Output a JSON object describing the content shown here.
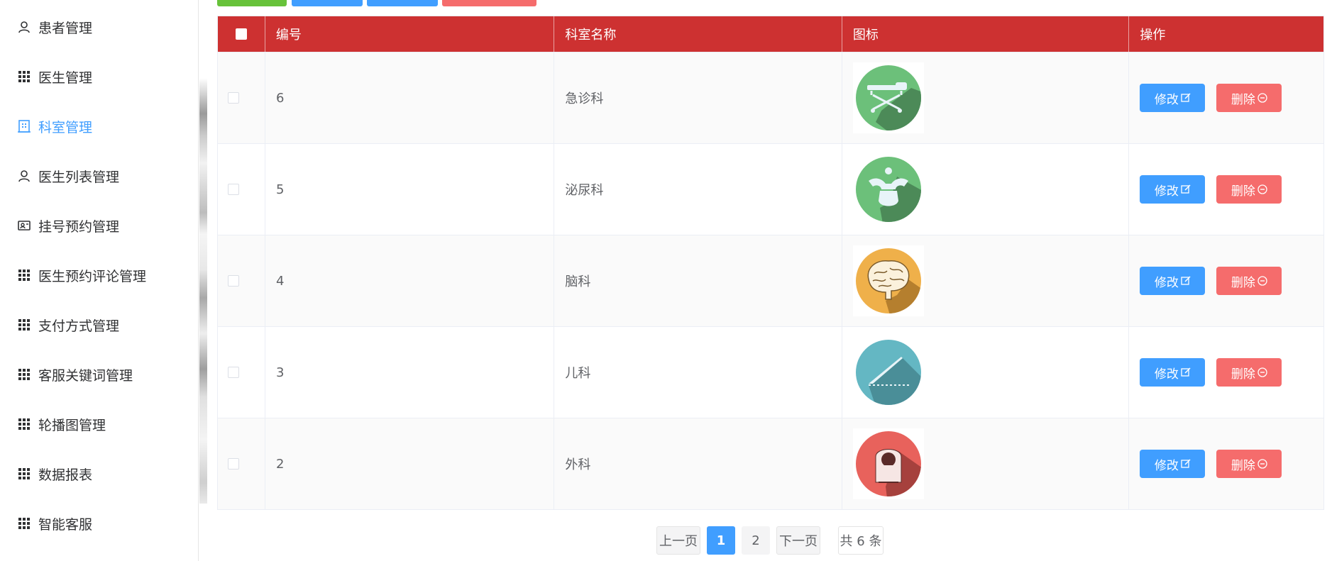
{
  "sidebar": {
    "items": [
      {
        "label": "患者管理",
        "icon": "user-icon",
        "active": false
      },
      {
        "label": "医生管理",
        "icon": "grid-icon",
        "active": false
      },
      {
        "label": "科室管理",
        "icon": "building-icon",
        "active": true
      },
      {
        "label": "医生列表管理",
        "icon": "user-icon",
        "active": false
      },
      {
        "label": "挂号预约管理",
        "icon": "id-card-icon",
        "active": false
      },
      {
        "label": "医生预约评论管理",
        "icon": "grid-icon",
        "active": false
      },
      {
        "label": "支付方式管理",
        "icon": "grid-icon",
        "active": false
      },
      {
        "label": "客服关键词管理",
        "icon": "grid-icon",
        "active": false
      },
      {
        "label": "轮播图管理",
        "icon": "grid-icon",
        "active": false
      },
      {
        "label": "数据报表",
        "icon": "grid-icon",
        "active": false
      },
      {
        "label": "智能客服",
        "icon": "grid-icon",
        "active": false
      }
    ]
  },
  "toolbar": {
    "colors": [
      "#67c23a",
      "#409eff",
      "#409eff",
      "#f56c6c"
    ]
  },
  "table": {
    "header": {
      "id": "编号",
      "name": "科室名称",
      "icon": "图标",
      "actions": "操作"
    },
    "header_color": "#cd3131",
    "rows": [
      {
        "id": "6",
        "name": "急诊科",
        "icon": "stretcher-icon",
        "icon_color": "#6cc07a"
      },
      {
        "id": "5",
        "name": "泌尿科",
        "icon": "spine-icon",
        "icon_color": "#6cc07a"
      },
      {
        "id": "4",
        "name": "脑科",
        "icon": "brain-icon",
        "icon_color": "#efb04a"
      },
      {
        "id": "3",
        "name": "儿科",
        "icon": "ruler-icon",
        "icon_color": "#64b7c3"
      },
      {
        "id": "2",
        "name": "外科",
        "icon": "scanner-icon",
        "icon_color": "#e8625c"
      }
    ],
    "edit_label": "修改",
    "delete_label": "删除"
  },
  "pagination": {
    "prev": "上一页",
    "pages": [
      "1",
      "2"
    ],
    "current": "1",
    "next": "下一页",
    "total": "共 6 条"
  }
}
